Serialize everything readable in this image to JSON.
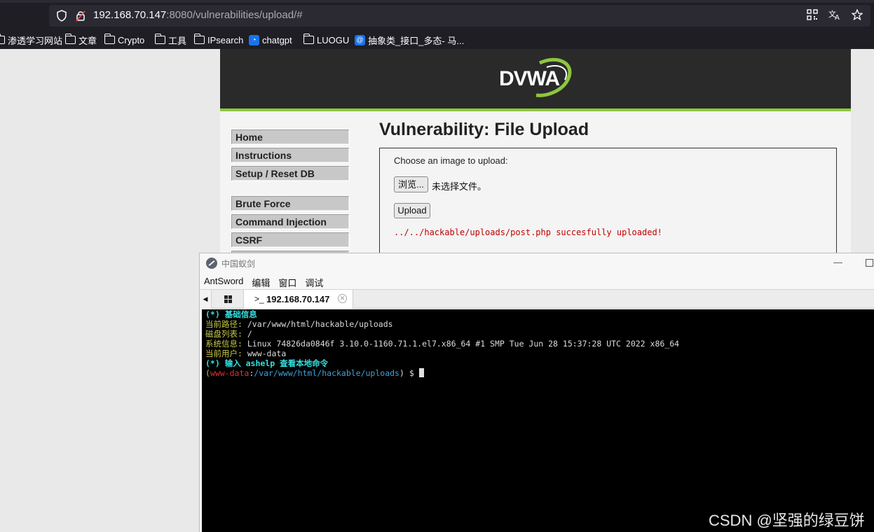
{
  "browser": {
    "url_host": "192.168.70.147",
    "url_rest": ":8080/vulnerabilities/upload/#",
    "bookmarks": [
      {
        "label": "渗透学习网站",
        "icon": "folder-icon"
      },
      {
        "label": "文章",
        "icon": "folder-icon"
      },
      {
        "label": "Crypto",
        "icon": "folder-icon"
      },
      {
        "label": "工具",
        "icon": "folder-icon"
      },
      {
        "label": "IPsearch",
        "icon": "folder-icon"
      },
      {
        "label": "chatgpt",
        "icon": "chat-favicon"
      },
      {
        "label": "LUOGU",
        "icon": "folder-icon"
      },
      {
        "label": "抽象类_接口_多态- 马...",
        "icon": "site-favicon"
      }
    ]
  },
  "dvwa": {
    "logo_text": "DVWA",
    "menu": [
      "Home",
      "Instructions",
      "Setup / Reset DB",
      "Brute Force",
      "Command Injection",
      "CSRF"
    ],
    "title": "Vulnerability: File Upload",
    "upload_label": "Choose an image to upload:",
    "browse_label": "浏览...",
    "no_file_text": "未选择文件。",
    "upload_button": "Upload",
    "success_message": "../../hackable/uploads/post.php succesfully uploaded!"
  },
  "antsword": {
    "window_title": "中国蚁剑",
    "menu": [
      "AntSword",
      "编辑",
      "窗口",
      "调试"
    ],
    "tab_prompt": ">_",
    "tab_label": "192.168.70.147",
    "terminal": {
      "heading_basic": "(*) 基础信息",
      "path_label": "当前路径:",
      "path_value": " /var/www/html/hackable/uploads",
      "disk_label": "磁盘列表:",
      "disk_value": " /",
      "sys_label": "系统信息:",
      "sys_value": " Linux 74826da0846f 3.10.0-1160.71.1.el7.x86_64 #1 SMP Tue Jun 28 15:37:28 UTC 2022 x86_64",
      "user_label": "当前用户:",
      "user_value": " www-data",
      "hint": "(*) 输入 ashelp 查看本地命令",
      "prompt_open": "(",
      "prompt_user": "www-data",
      "prompt_colon": ":",
      "prompt_path": "/var/www/html/hackable/uploads",
      "prompt_close": ") $ "
    }
  },
  "watermark": "CSDN @坚强的绿豆饼"
}
